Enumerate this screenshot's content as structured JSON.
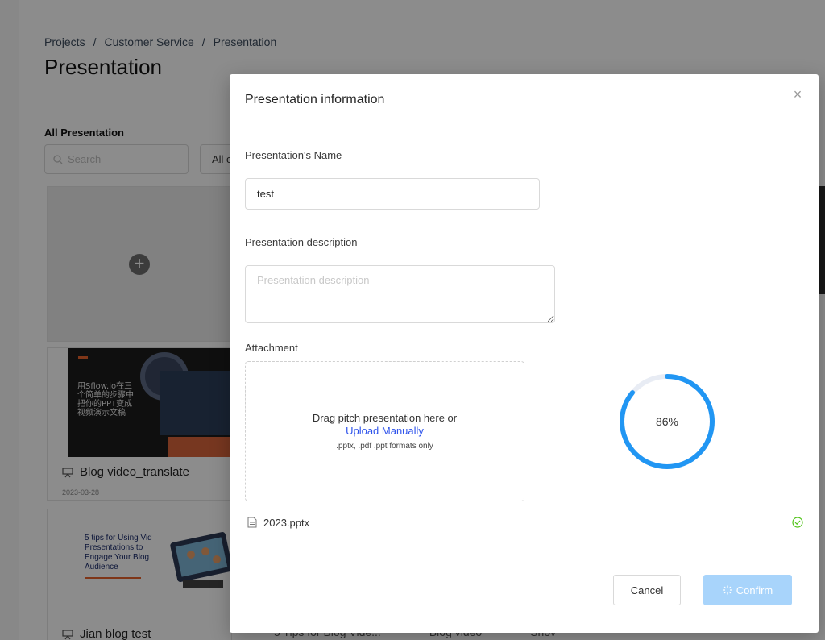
{
  "background": {
    "breadcrumb": [
      "Projects",
      "Customer Service",
      "Presentation"
    ],
    "breadcrumb_separator": "/",
    "page_title": "Presentation",
    "section_label": "All Presentation",
    "search_placeholder": "Search",
    "filter_value": "All c",
    "cards": [
      {
        "title": "Blog video_translate",
        "date": "2023-03-28",
        "thumb_text": "用Sflow.io在三个简单的步骤中把你的PPT变成视频演示文稿"
      },
      {
        "title": "Jian blog test",
        "thumb_text": "5 tips for Using Vid Presentations to Engage Your Blog Audience"
      }
    ],
    "bottom_cards": [
      "5 Tips for Blog Vide...",
      "Blog video",
      "Shov"
    ]
  },
  "modal": {
    "title": "Presentation information",
    "close_label": "×",
    "name_label": "Presentation's Name",
    "name_value": "test",
    "description_label": "Presentation description",
    "description_placeholder": "Presentation description",
    "attachment_label": "Attachment",
    "dropzone_text": "Drag pitch presentation here or",
    "dropzone_link": "Upload Manually",
    "dropzone_formats": ".pptx, .pdf .ppt formats only",
    "upload_progress_percent": 86,
    "upload_progress_label": "86%",
    "file_name": "2023.pptx",
    "cancel_label": "Cancel",
    "confirm_label": "Confirm",
    "colors": {
      "progress": "#2196f3",
      "progress_track": "#e8ecf4",
      "link": "#2f54eb",
      "confirm_disabled": "#a8d4fb",
      "success": "#52c41a"
    }
  }
}
